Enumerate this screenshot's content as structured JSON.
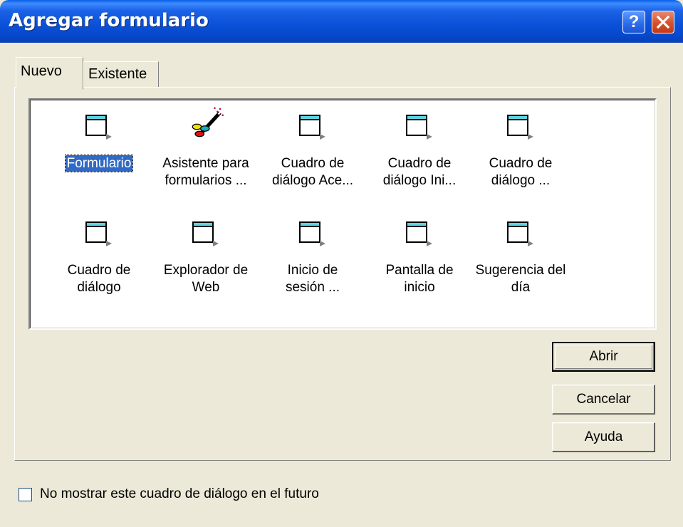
{
  "window": {
    "title": "Agregar formulario",
    "help_glyph": "?",
    "close_glyph": "✕"
  },
  "tabs": [
    {
      "label": "Nuevo",
      "active": true
    },
    {
      "label": "Existente",
      "active": false
    }
  ],
  "list": {
    "items": [
      {
        "label": "Formulario",
        "icon": "form-icon",
        "selected": true
      },
      {
        "label": "Asistente para\nformularios ...",
        "icon": "wizard-icon",
        "selected": false
      },
      {
        "label": "Cuadro de\ndiálogo Ace...",
        "icon": "form-icon",
        "selected": false
      },
      {
        "label": "Cuadro de\ndiálogo Ini...",
        "icon": "form-icon",
        "selected": false
      },
      {
        "label": "Cuadro de\ndiálogo ...",
        "icon": "form-icon",
        "selected": false
      },
      {
        "label": "Cuadro de\ndiálogo",
        "icon": "form-icon",
        "selected": false
      },
      {
        "label": "Explorador de\nWeb",
        "icon": "form-icon",
        "selected": false
      },
      {
        "label": "Inicio de\nsesión ...",
        "icon": "form-icon",
        "selected": false
      },
      {
        "label": "Pantalla de\ninicio",
        "icon": "form-icon",
        "selected": false
      },
      {
        "label": "Sugerencia del\ndía",
        "icon": "form-icon",
        "selected": false
      }
    ]
  },
  "buttons": {
    "open": "Abrir",
    "cancel": "Cancelar",
    "help": "Ayuda"
  },
  "footer": {
    "checkbox_label": "No mostrar este cuadro de diálogo en el futuro",
    "checkbox_checked": false
  },
  "colors": {
    "titlebar": "#0a50d8",
    "selection": "#316ac5",
    "dialog_bg": "#ece9d8"
  }
}
